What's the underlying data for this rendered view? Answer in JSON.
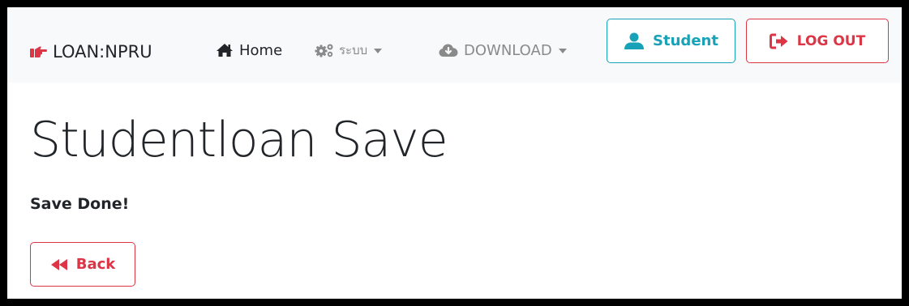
{
  "navbar": {
    "brand": "LOAN:NPRU",
    "brand_icon": "hand-point-right-icon",
    "home_label": "Home",
    "menu_label": "ระบบ",
    "download_label": "DOWNLOAD",
    "student_label": "Student",
    "logout_label": "LOG OUT"
  },
  "main": {
    "title": "Studentloan Save",
    "status": "Save Done!",
    "back_label": "Back"
  },
  "colors": {
    "info": "#17a2b8",
    "danger": "#dc3545",
    "navbar_bg": "#f8f9fa",
    "text": "#212529",
    "muted": "#8a8a8a"
  }
}
